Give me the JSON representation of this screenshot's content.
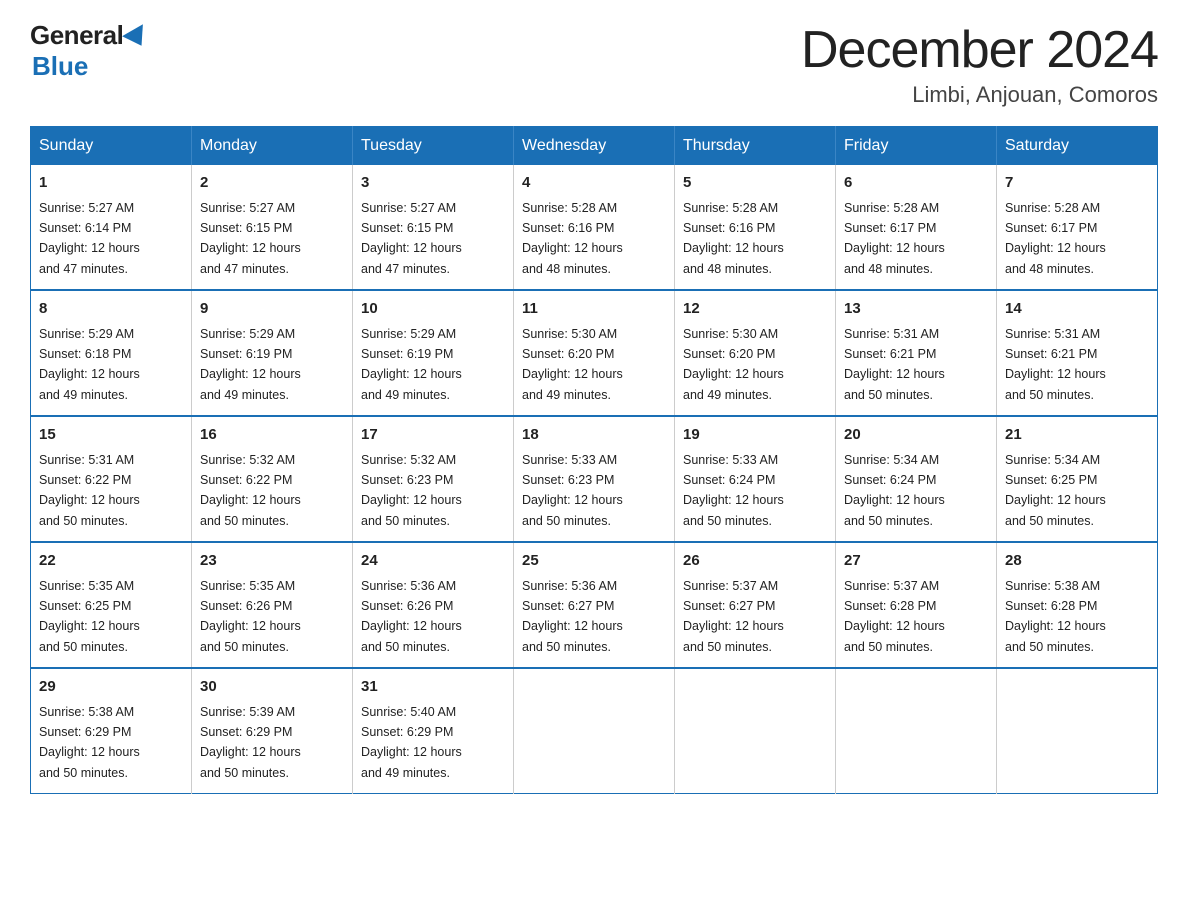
{
  "header": {
    "logo_general": "General",
    "logo_blue": "Blue",
    "month_title": "December 2024",
    "location": "Limbi, Anjouan, Comoros"
  },
  "weekdays": [
    "Sunday",
    "Monday",
    "Tuesday",
    "Wednesday",
    "Thursday",
    "Friday",
    "Saturday"
  ],
  "weeks": [
    [
      {
        "day": "1",
        "sunrise": "5:27 AM",
        "sunset": "6:14 PM",
        "daylight": "12 hours and 47 minutes."
      },
      {
        "day": "2",
        "sunrise": "5:27 AM",
        "sunset": "6:15 PM",
        "daylight": "12 hours and 47 minutes."
      },
      {
        "day": "3",
        "sunrise": "5:27 AM",
        "sunset": "6:15 PM",
        "daylight": "12 hours and 47 minutes."
      },
      {
        "day": "4",
        "sunrise": "5:28 AM",
        "sunset": "6:16 PM",
        "daylight": "12 hours and 48 minutes."
      },
      {
        "day": "5",
        "sunrise": "5:28 AM",
        "sunset": "6:16 PM",
        "daylight": "12 hours and 48 minutes."
      },
      {
        "day": "6",
        "sunrise": "5:28 AM",
        "sunset": "6:17 PM",
        "daylight": "12 hours and 48 minutes."
      },
      {
        "day": "7",
        "sunrise": "5:28 AM",
        "sunset": "6:17 PM",
        "daylight": "12 hours and 48 minutes."
      }
    ],
    [
      {
        "day": "8",
        "sunrise": "5:29 AM",
        "sunset": "6:18 PM",
        "daylight": "12 hours and 49 minutes."
      },
      {
        "day": "9",
        "sunrise": "5:29 AM",
        "sunset": "6:19 PM",
        "daylight": "12 hours and 49 minutes."
      },
      {
        "day": "10",
        "sunrise": "5:29 AM",
        "sunset": "6:19 PM",
        "daylight": "12 hours and 49 minutes."
      },
      {
        "day": "11",
        "sunrise": "5:30 AM",
        "sunset": "6:20 PM",
        "daylight": "12 hours and 49 minutes."
      },
      {
        "day": "12",
        "sunrise": "5:30 AM",
        "sunset": "6:20 PM",
        "daylight": "12 hours and 49 minutes."
      },
      {
        "day": "13",
        "sunrise": "5:31 AM",
        "sunset": "6:21 PM",
        "daylight": "12 hours and 50 minutes."
      },
      {
        "day": "14",
        "sunrise": "5:31 AM",
        "sunset": "6:21 PM",
        "daylight": "12 hours and 50 minutes."
      }
    ],
    [
      {
        "day": "15",
        "sunrise": "5:31 AM",
        "sunset": "6:22 PM",
        "daylight": "12 hours and 50 minutes."
      },
      {
        "day": "16",
        "sunrise": "5:32 AM",
        "sunset": "6:22 PM",
        "daylight": "12 hours and 50 minutes."
      },
      {
        "day": "17",
        "sunrise": "5:32 AM",
        "sunset": "6:23 PM",
        "daylight": "12 hours and 50 minutes."
      },
      {
        "day": "18",
        "sunrise": "5:33 AM",
        "sunset": "6:23 PM",
        "daylight": "12 hours and 50 minutes."
      },
      {
        "day": "19",
        "sunrise": "5:33 AM",
        "sunset": "6:24 PM",
        "daylight": "12 hours and 50 minutes."
      },
      {
        "day": "20",
        "sunrise": "5:34 AM",
        "sunset": "6:24 PM",
        "daylight": "12 hours and 50 minutes."
      },
      {
        "day": "21",
        "sunrise": "5:34 AM",
        "sunset": "6:25 PM",
        "daylight": "12 hours and 50 minutes."
      }
    ],
    [
      {
        "day": "22",
        "sunrise": "5:35 AM",
        "sunset": "6:25 PM",
        "daylight": "12 hours and 50 minutes."
      },
      {
        "day": "23",
        "sunrise": "5:35 AM",
        "sunset": "6:26 PM",
        "daylight": "12 hours and 50 minutes."
      },
      {
        "day": "24",
        "sunrise": "5:36 AM",
        "sunset": "6:26 PM",
        "daylight": "12 hours and 50 minutes."
      },
      {
        "day": "25",
        "sunrise": "5:36 AM",
        "sunset": "6:27 PM",
        "daylight": "12 hours and 50 minutes."
      },
      {
        "day": "26",
        "sunrise": "5:37 AM",
        "sunset": "6:27 PM",
        "daylight": "12 hours and 50 minutes."
      },
      {
        "day": "27",
        "sunrise": "5:37 AM",
        "sunset": "6:28 PM",
        "daylight": "12 hours and 50 minutes."
      },
      {
        "day": "28",
        "sunrise": "5:38 AM",
        "sunset": "6:28 PM",
        "daylight": "12 hours and 50 minutes."
      }
    ],
    [
      {
        "day": "29",
        "sunrise": "5:38 AM",
        "sunset": "6:29 PM",
        "daylight": "12 hours and 50 minutes."
      },
      {
        "day": "30",
        "sunrise": "5:39 AM",
        "sunset": "6:29 PM",
        "daylight": "12 hours and 50 minutes."
      },
      {
        "day": "31",
        "sunrise": "5:40 AM",
        "sunset": "6:29 PM",
        "daylight": "12 hours and 49 minutes."
      },
      null,
      null,
      null,
      null
    ]
  ],
  "labels": {
    "sunrise": "Sunrise:",
    "sunset": "Sunset:",
    "daylight": "Daylight:"
  }
}
